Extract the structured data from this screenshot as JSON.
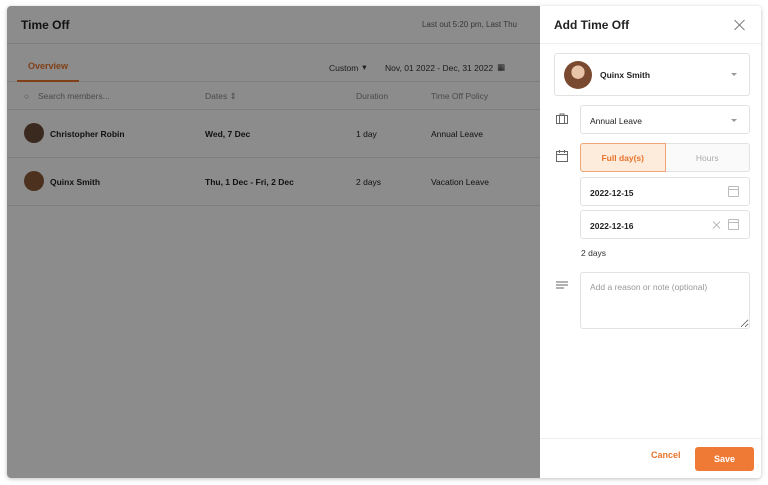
{
  "page": {
    "title": "Time Off",
    "last_out": "Last out 5:20 pm, Last Thu",
    "tabs": {
      "overview": "Overview"
    },
    "filters": {
      "range": "Custom",
      "dates": "Nov, 01 2022 - Dec, 31 2022"
    },
    "table": {
      "headers": {
        "search_placeholder": "Search members...",
        "dates": "Dates",
        "duration": "Duration",
        "policy": "Time Off Policy"
      },
      "rows": [
        {
          "name": "Christopher Robin",
          "dates": "Wed, 7 Dec",
          "duration": "1 day",
          "policy": "Annual Leave"
        },
        {
          "name": "Quinx Smith",
          "dates": "Thu, 1 Dec - Fri, 2 Dec",
          "duration": "2 days",
          "policy": "Vacation Leave"
        }
      ]
    }
  },
  "drawer": {
    "title": "Add Time Off",
    "member": "Quinx Smith",
    "policy": "Annual Leave",
    "mode": {
      "full": "Full day(s)",
      "hours": "Hours"
    },
    "start_date": "2022-12-15",
    "end_date": "2022-12-16",
    "days_count": "2 days",
    "note_placeholder": "Add a reason or note (optional)",
    "cancel": "Cancel",
    "save": "Save"
  },
  "colors": {
    "accent": "#e8742c",
    "overlay": "rgba(0,0,0,0.45)"
  }
}
